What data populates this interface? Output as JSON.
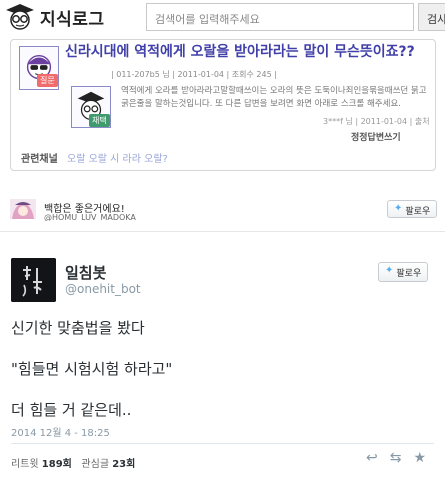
{
  "kin": {
    "logo_text": "지식로그",
    "search_placeholder": "검색어를 입력해주세요",
    "search_button": "검사",
    "question": {
      "badge": "질문",
      "title": "신라시대에 역적에게 오랄을 받아라라는 말이 무슨뜻이죠??",
      "meta": "| 011-207b5 님 | 2011-01-04 | 조회수 245 |"
    },
    "answer": {
      "badge": "채택",
      "text": "역적에게 오라를 받아라라고말할때쓰이는 오라의 뜻은 도둑이나죄인을묶을때쓰던 붉고 굵은줄을 말하는것입니다. 또 다른 답변을 보려면 화면 아래로 스크롤 해주세요.",
      "meta": "3***f 님 | 2011-01-04 | 출처",
      "link": "정정답변쓰기"
    },
    "related": {
      "label": "관련채널",
      "links": "오랄 오랄 시 라라 오랄?"
    }
  },
  "follow_card": {
    "name": "백합은 좋은거에요!",
    "handle": "@HOMU_LUV_MADOKA",
    "follow_label": "팔로우"
  },
  "tweet": {
    "name": "일침봇",
    "handle": "@onehit_bot",
    "avatar_text": "일침",
    "follow_label": "팔로우",
    "lines": [
      "신기한 맞춤법을 봤다",
      "\"힘들면 시험시험 하라고\"",
      "더 힘들 거 같은데.."
    ],
    "timestamp": "2014 12월 4 - 18:25",
    "retweets_label": "리트윗",
    "retweets_count": "189회",
    "likes_label": "관심글",
    "likes_count": "23회"
  },
  "colors": {
    "question_title": "#4040a8",
    "twitter_blue": "#55acee",
    "question_badge": "#f06b6b",
    "answer_badge": "#3f9a6e"
  }
}
